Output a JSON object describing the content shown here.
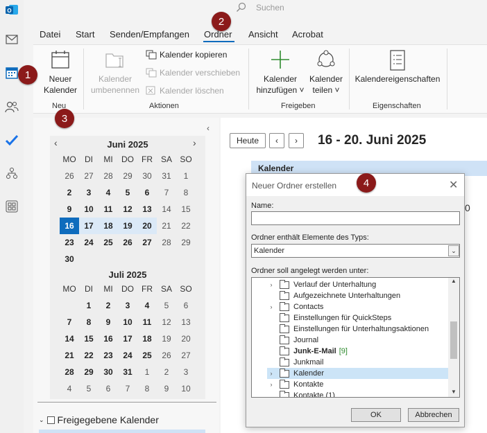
{
  "search": {
    "placeholder": "Suchen",
    "icon": "search-icon"
  },
  "menu": {
    "items": [
      "Datei",
      "Start",
      "Senden/Empfangen",
      "Ordner",
      "Ansicht",
      "Acrobat"
    ],
    "active": "Ordner"
  },
  "ribbon": {
    "new_calendar_line1": "Neuer",
    "new_calendar_line2": "Kalender",
    "rename_line1": "Kalender",
    "rename_line2": "umbenennen",
    "copy": "Kalender kopieren",
    "move": "Kalender verschieben",
    "delete": "Kalender löschen",
    "add_line1": "Kalender",
    "add_line2": "hinzufügen ˅",
    "share_line1": "Kalender",
    "share_line2": "teilen ˅",
    "properties": "Kalendereigenschaften",
    "groups": {
      "neu": "Neu",
      "aktionen": "Aktionen",
      "freigeben": "Freigeben",
      "eigenschaften": "Eigenschaften"
    }
  },
  "badges": [
    "1",
    "2",
    "3",
    "4"
  ],
  "minical": {
    "weekdays": [
      "MO",
      "DI",
      "MI",
      "DO",
      "FR",
      "SA",
      "SO"
    ],
    "june": {
      "title": "Juni 2025",
      "weeks": [
        [
          "26",
          "27",
          "28",
          "29",
          "30",
          "31",
          "1"
        ],
        [
          "2",
          "3",
          "4",
          "5",
          "6",
          "7",
          "8"
        ],
        [
          "9",
          "10",
          "11",
          "12",
          "13",
          "14",
          "15"
        ],
        [
          "16",
          "17",
          "18",
          "19",
          "20",
          "21",
          "22"
        ],
        [
          "23",
          "24",
          "25",
          "26",
          "27",
          "28",
          "29"
        ],
        [
          "30"
        ]
      ]
    },
    "july": {
      "title": "Juli 2025",
      "weeks": [
        [
          "",
          "1",
          "2",
          "3",
          "4",
          "5",
          "6"
        ],
        [
          "7",
          "8",
          "9",
          "10",
          "11",
          "12",
          "13"
        ],
        [
          "14",
          "15",
          "16",
          "17",
          "18",
          "19",
          "20"
        ],
        [
          "21",
          "22",
          "23",
          "24",
          "25",
          "26",
          "27"
        ],
        [
          "28",
          "29",
          "30",
          "31",
          "1",
          "2",
          "3"
        ],
        [
          "4",
          "5",
          "6",
          "7",
          "8",
          "9",
          "10"
        ]
      ]
    }
  },
  "shared": {
    "label": "Freigegebene Kalender"
  },
  "main": {
    "today_button": "Heute",
    "range": "16 - 20. Juni 2025",
    "calendar_header": "Kalender",
    "partial_digit": "0"
  },
  "dialog": {
    "title": "Neuer Ordner erstellen",
    "name_label": "Name:",
    "name_value": "",
    "type_label": "Ordner enthält Elemente des Typs:",
    "type_value": "Kalender",
    "location_label": "Ordner soll angelegt werden unter:",
    "tree": [
      {
        "label": "Verlauf der Unterhaltung",
        "expandable": true
      },
      {
        "label": "Aufgezeichnete Unterhaltungen",
        "expandable": false
      },
      {
        "label": "Contacts",
        "expandable": true
      },
      {
        "label": "Einstellungen für QuickSteps",
        "expandable": false
      },
      {
        "label": "Einstellungen für Unterhaltungsaktionen",
        "expandable": false
      },
      {
        "label": "Journal",
        "expandable": false
      },
      {
        "label": "Junk-E-Mail",
        "count": "[9]",
        "expandable": false
      },
      {
        "label": "Junkmail",
        "expandable": false
      },
      {
        "label": "Kalender",
        "expandable": true,
        "selected": true
      },
      {
        "label": "Kontakte",
        "expandable": true
      },
      {
        "label": "Kontakte (1)",
        "expandable": false
      }
    ],
    "ok": "OK",
    "cancel": "Abbrechen"
  },
  "colors": {
    "accent": "#0f6cbd",
    "badge": "#8b1a1a",
    "green": "#2e8b2e"
  }
}
